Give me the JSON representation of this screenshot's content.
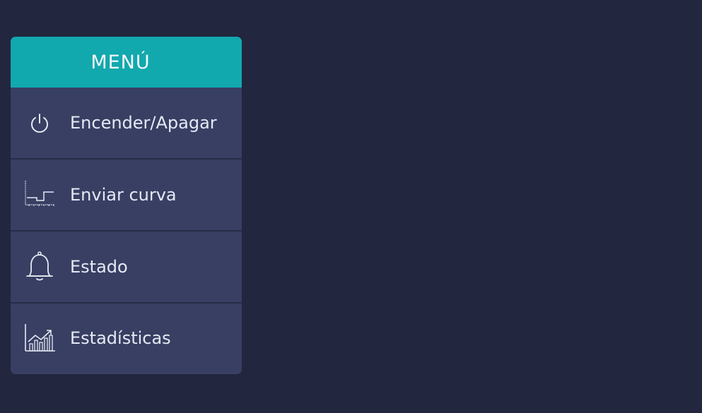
{
  "theme": {
    "background": "#22263e",
    "panel": "#383f63",
    "header": "#11a8ae",
    "separator": "#262b45",
    "text": "#e6e9f3"
  },
  "menu": {
    "title": "MENÚ",
    "items": [
      {
        "label": "Encender/Apagar",
        "icon": "power-icon"
      },
      {
        "label": "Enviar curva",
        "icon": "step-curve-chart-icon"
      },
      {
        "label": "Estado",
        "icon": "bell-icon"
      },
      {
        "label": "Estadísticas",
        "icon": "rising-bar-chart-icon"
      }
    ]
  }
}
